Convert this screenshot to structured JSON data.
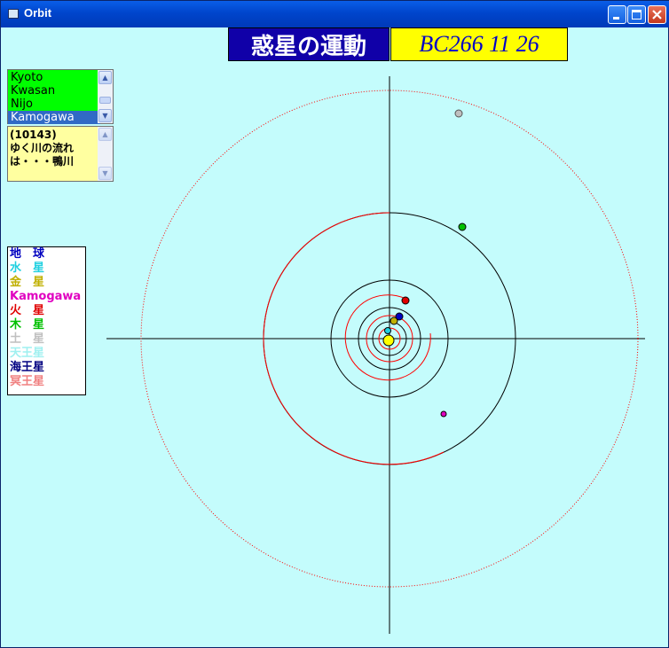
{
  "window": {
    "title": "Orbit",
    "controls": {
      "minimize": "_",
      "maximize": "□",
      "close": "✕"
    }
  },
  "header": {
    "title": "惑星の運動",
    "date": "BC266 11 26"
  },
  "locations": {
    "items": [
      "Kyoto",
      "Kwasan",
      "Nijo",
      "Kamogawa"
    ],
    "selected": "Kamogawa"
  },
  "info": {
    "text": "(10143)\nゆく川の流れ\nは・・・鴨川"
  },
  "legend": [
    {
      "label": "地　球",
      "color": "#0000c0"
    },
    {
      "label": "水　星",
      "color": "#20d0e0"
    },
    {
      "label": "金　星",
      "color": "#c0b000"
    },
    {
      "label": "Kamogawa",
      "color": "#e000c0"
    },
    {
      "label": "火　星",
      "color": "#e00000"
    },
    {
      "label": "木　星",
      "color": "#00c000"
    },
    {
      "label": "土　星",
      "color": "#c0c0c0"
    },
    {
      "label": "天王星",
      "color": "#a0f0f0"
    },
    {
      "label": "海王星",
      "color": "#000080"
    },
    {
      "label": "冥王星",
      "color": "#f08080"
    }
  ],
  "colors": {
    "background": "#c4fcfc",
    "sun": "#ffff00",
    "orbit_inner": "#000000",
    "orbit_red": "#ff0000"
  },
  "planets": [
    {
      "name": "sun",
      "color": "#ffff00"
    },
    {
      "name": "mercury",
      "color": "#20d0e0"
    },
    {
      "name": "venus",
      "color": "#c0b000"
    },
    {
      "name": "earth",
      "color": "#0000c0"
    },
    {
      "name": "mars",
      "color": "#e00000"
    },
    {
      "name": "jupiter",
      "color": "#00c000"
    },
    {
      "name": "saturn",
      "color": "#c0c0c0"
    },
    {
      "name": "kamogawa",
      "color": "#e000c0"
    }
  ]
}
